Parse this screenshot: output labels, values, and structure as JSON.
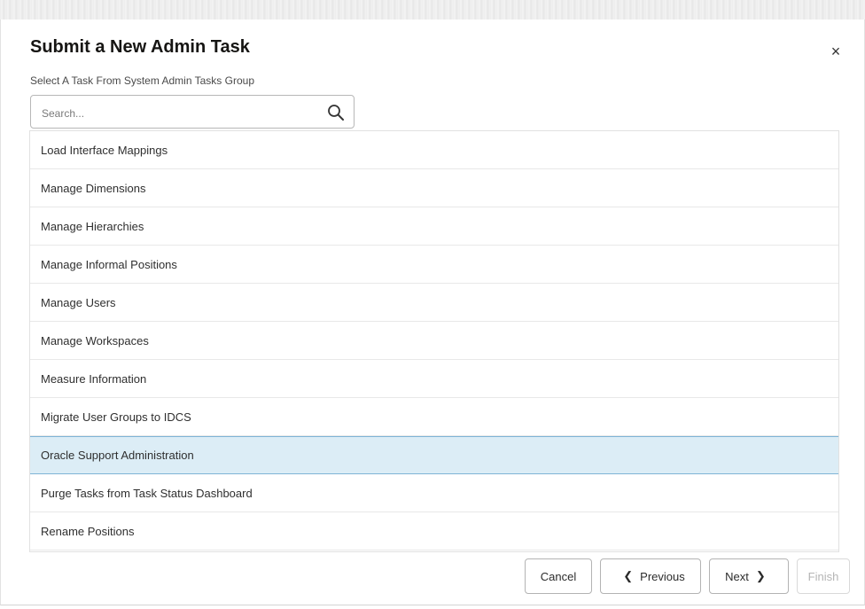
{
  "dialog": {
    "title": "Submit a New Admin Task",
    "subtitle": "Select A Task From System Admin Tasks Group",
    "close_symbol": "×"
  },
  "search": {
    "placeholder": "Search...",
    "value": "",
    "icon": "search-icon"
  },
  "tasks": [
    {
      "label": "Load Interface Mappings",
      "selected": false
    },
    {
      "label": "Manage Dimensions",
      "selected": false
    },
    {
      "label": "Manage Hierarchies",
      "selected": false
    },
    {
      "label": "Manage Informal Positions",
      "selected": false
    },
    {
      "label": "Manage Users",
      "selected": false
    },
    {
      "label": "Manage Workspaces",
      "selected": false
    },
    {
      "label": "Measure Information",
      "selected": false
    },
    {
      "label": "Migrate User Groups to IDCS",
      "selected": false
    },
    {
      "label": "Oracle Support Administration",
      "selected": true
    },
    {
      "label": "Purge Tasks from Task Status Dashboard",
      "selected": false
    },
    {
      "label": "Rename Positions",
      "selected": false
    }
  ],
  "footer": {
    "cancel_label": "Cancel",
    "previous_label": "Previous",
    "next_label": "Next",
    "finish_label": "Finish",
    "previous_chevron": "❮",
    "next_chevron": "❯"
  },
  "colors": {
    "selected_row_bg": "#dcedf6",
    "selected_row_border": "#7fb4d6",
    "disabled_text": "#b5b5b5"
  }
}
